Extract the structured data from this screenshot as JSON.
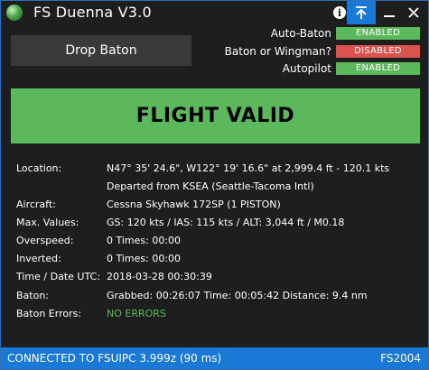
{
  "window": {
    "title": "FS Duenna V3.0"
  },
  "titlebar": {
    "info_icon_glyph": "i",
    "pin_icon_glyph": "⇡",
    "minimize_glyph": "—",
    "close_glyph": "✕"
  },
  "actions": {
    "drop_baton_label": "Drop Baton"
  },
  "toggles": [
    {
      "label": "Auto-Baton",
      "state": "ENABLED",
      "color": "#5cb85c"
    },
    {
      "label": "Baton or Wingman?",
      "state": "DISABLED",
      "color": "#d9534f"
    },
    {
      "label": "Autopilot",
      "state": "ENABLED",
      "color": "#5cb85c"
    }
  ],
  "banner": {
    "text": "FLIGHT VALID",
    "color": "#5cb85c"
  },
  "details": {
    "location_label": "Location:",
    "location_value": "N47° 35' 24.6\", W122° 19' 16.6\" at 2,999.4 ft - 120.1 kts",
    "location_extra": "Departed from KSEA (Seattle-Tacoma Intl)",
    "aircraft_label": "Aircraft:",
    "aircraft_value": "Cessna Skyhawk 172SP (1 PISTON)",
    "max_label": "Max. Values:",
    "max_value": "GS: 120 kts / IAS: 115 kts / ALT: 3,044 ft / M0.18",
    "overspeed_label": "Overspeed:",
    "overspeed_value": "0 Times: 00:00",
    "inverted_label": "Inverted:",
    "inverted_value": "0 Times: 00:00",
    "time_label": "Time / Date UTC:",
    "time_value": "2018-03-28 00:30:39",
    "baton_label": "Baton:",
    "baton_value": "Grabbed: 00:26:07 Time: 00:05:42 Distance: 9.4 nm",
    "errors_label": "Baton Errors:",
    "errors_value": "NO ERRORS"
  },
  "statusbar": {
    "connection": "CONNECTED TO FSUIPC 3.999z (90 ms)",
    "sim": "FS2004",
    "color": "#1a78d6"
  }
}
